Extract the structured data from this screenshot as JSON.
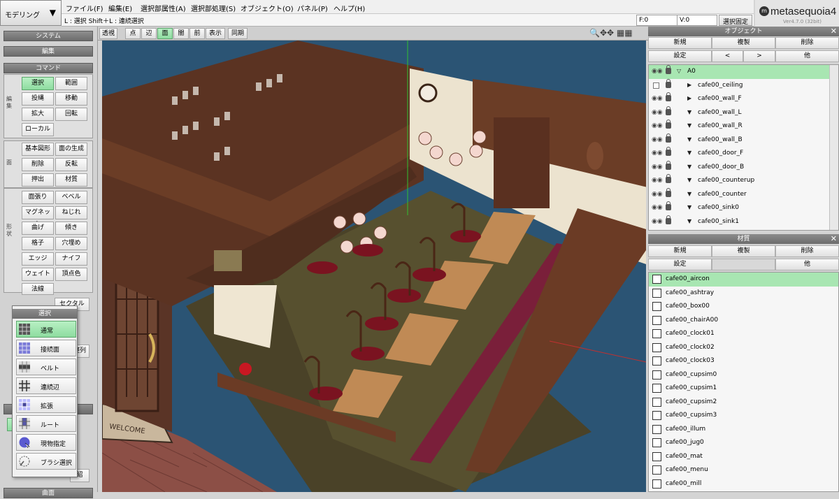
{
  "mode": {
    "label": "モデリング",
    "arrow": "▼"
  },
  "menu": [
    "ファイル(F)",
    "編集(E)",
    "選択部属性(A)",
    "選択部処理(S)",
    "オブジェクト(O)",
    "パネル(P)",
    "ヘルプ(H)"
  ],
  "status": {
    "text": "L : 選択 Shift＋L : 連続選択",
    "f": "F:0",
    "v": "V:0",
    "select_fix": "選択固定"
  },
  "logo": {
    "name": "metasequoia",
    "version_num": "4",
    "version": "Ver4.7.0 (32bit)"
  },
  "left": {
    "system": "システム",
    "edit": "編集",
    "command": "コマンド",
    "group1_label": "編集",
    "group1": [
      "選択",
      "範囲",
      "投縄",
      "移動",
      "拡大",
      "回転",
      "ローカル"
    ],
    "group2_label": "面",
    "group2": [
      "基本図形",
      "面の生成",
      "削除",
      "反転",
      "押出",
      "材質"
    ],
    "group3_label": "形状",
    "group3": [
      "面張り",
      "ベベル",
      "マグネット",
      "ねじれ",
      "曲げ",
      "傾き",
      "格子",
      "穴埋め",
      "エッジ",
      "ナイフ",
      "ウェイト",
      "頂点色",
      "法線"
    ],
    "partial_right": [
      "セクタル",
      "整列",
      "紹"
    ],
    "bottom_label": "曲面"
  },
  "select_popup": {
    "title": "選択",
    "items": [
      "通常",
      "接続面",
      "ベルト",
      "連続辺",
      "拡張",
      "ルート",
      "現物指定",
      "ブラシ選択"
    ]
  },
  "view_toolbar": [
    "透視",
    "点",
    "辺",
    "面",
    "闇",
    "前",
    "表示",
    "同期"
  ],
  "view_icons": "🔍✥✥ ▦▦",
  "object_panel": {
    "title": "オブジェクト",
    "buttons_row1": [
      "新規",
      "複製",
      "削除"
    ],
    "buttons_row2": [
      "設定",
      "<",
      ">",
      "他"
    ],
    "items": [
      {
        "name": "A0",
        "arrow": "▽",
        "eye": "◉◉",
        "selected": true,
        "indent": 0
      },
      {
        "name": "cafe00_ceiling",
        "arrow": "▶",
        "eye": "",
        "selected": false,
        "indent": 1
      },
      {
        "name": "cafe00_wall_F",
        "arrow": "▶",
        "eye": "◉◉",
        "selected": false,
        "indent": 1
      },
      {
        "name": "cafe00_wall_L",
        "arrow": "▼",
        "eye": "◉◉",
        "selected": false,
        "indent": 1
      },
      {
        "name": "cafe00_wall_R",
        "arrow": "▼",
        "eye": "◉◉",
        "selected": false,
        "indent": 1
      },
      {
        "name": "cafe00_wall_B",
        "arrow": "▼",
        "eye": "◉◉",
        "selected": false,
        "indent": 1
      },
      {
        "name": "cafe00_door_F",
        "arrow": "▼",
        "eye": "◉◉",
        "selected": false,
        "indent": 1
      },
      {
        "name": "cafe00_door_B",
        "arrow": "▼",
        "eye": "◉◉",
        "selected": false,
        "indent": 1
      },
      {
        "name": "cafe00_counterup",
        "arrow": "▼",
        "eye": "◉◉",
        "selected": false,
        "indent": 1
      },
      {
        "name": "cafe00_counter",
        "arrow": "▼",
        "eye": "◉◉",
        "selected": false,
        "indent": 1
      },
      {
        "name": "cafe00_sink0",
        "arrow": "▼",
        "eye": "◉◉",
        "selected": false,
        "indent": 1
      },
      {
        "name": "cafe00_sink1",
        "arrow": "▼",
        "eye": "◉◉",
        "selected": false,
        "indent": 1
      }
    ]
  },
  "material_panel": {
    "title": "材質",
    "buttons_row1": [
      "新規",
      "複製",
      "削除"
    ],
    "buttons_row2": [
      "設定",
      "",
      "他"
    ],
    "items": [
      "cafe00_aircon",
      "cafe00_ashtray",
      "cafe00_box00",
      "cafe00_chairA00",
      "cafe00_clock01",
      "cafe00_clock02",
      "cafe00_clock03",
      "cafe00_cupsim0",
      "cafe00_cupsim1",
      "cafe00_cupsim2",
      "cafe00_cupsim3",
      "cafe00_illum",
      "cafe00_jug0",
      "cafe00_mat",
      "cafe00_menu",
      "cafe00_mill"
    ],
    "selected_index": 0
  },
  "scene": {
    "doormat_text": "WELCOME"
  },
  "colors": {
    "accent_green": "#8edca0",
    "viewport_bg": "#2b5474",
    "panel_head": "#7a7a7a"
  }
}
